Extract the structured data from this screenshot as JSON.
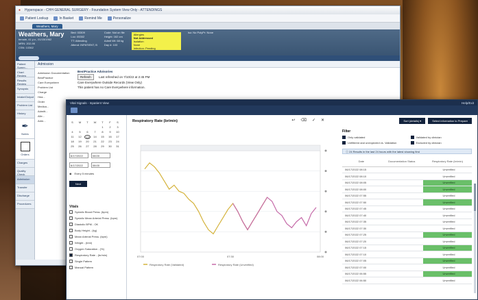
{
  "back_window": {
    "title": "Hyperspace - CHH GENERAL SURGERY - Foundation System View Only - ATTENDINGS",
    "toolbar": [
      "Patient Lookup",
      "In Basket",
      "Remind Me",
      "Personalize"
    ],
    "tab": "Weathers, Mary",
    "patient": {
      "name": "Weathers, Mary",
      "line1": "female, 41 y.o., 01/15/1962",
      "line2": "MRN: 202-98",
      "line3": "CSN: 10362"
    },
    "banner_cols": [
      [
        "Bed: 03309",
        "Loc: 05302",
        "TT: Attending",
        "Attend: INPATIENT, B"
      ],
      [
        "Code: Not on file",
        "Height: 162 cm",
        "Admit Wt: 68 kg",
        "Day #: 103"
      ]
    ],
    "allergy": [
      "Allergies",
      "Not Addressed",
      "Isolation",
      "None",
      "Infection: Pending"
    ],
    "iso_label": "Iso: No PolyPr: None",
    "sidebar": [
      "Patient Summ...",
      "Chart Review",
      "Results Review",
      "Synopsis",
      "Intake/Output",
      "Problem List",
      "History",
      "Notes",
      "Orders",
      "Charges",
      "Quality Check",
      "Admission",
      "Transfer",
      "Discharge",
      "Procedures"
    ],
    "section": "Admission",
    "left_list": [
      "Admission Documentation",
      "BestPractice",
      "Care Everywhere",
      "Problem List",
      "Charge",
      "Hea...",
      "Order",
      "Medica...",
      "Admitt...",
      "Alle...",
      "Adm..."
    ],
    "advisory_title": "BestPractice Advisories",
    "refresh": "Refresh",
    "last_refreshed": "Last refreshed on 7/10/22 at 2:45 PM",
    "care_text": "Care Everywhere Outside Records (View Only)",
    "care_sub": "This patient has no Care Everywhere information."
  },
  "front_window": {
    "title": "Vital Signals - Inpatient View",
    "title_right": "Help/Exit",
    "calendar": {
      "days": [
        "S",
        "M",
        "T",
        "W",
        "T",
        "F",
        "S",
        "",
        "",
        "",
        "",
        "1",
        "2",
        "3",
        "4",
        "5",
        "6",
        "7",
        "8",
        "9",
        "10",
        "11",
        "12",
        "13",
        "14",
        "15",
        "16",
        "17",
        "18",
        "19",
        "20",
        "21",
        "22",
        "23",
        "24",
        "25",
        "26",
        "27",
        "28",
        "29",
        "30",
        "31"
      ],
      "selected": 13
    },
    "from_date": "6/17/2022",
    "from_time": "08:00",
    "to_date": "6/17/2022",
    "to_time": "08:00",
    "interval_label": "Every 5 minutes",
    "next_label": "Next",
    "vitals_title": "Vitals",
    "vitals": [
      {
        "label": "Systolic Blood Press. (bpm)",
        "checked": false
      },
      {
        "label": "Systolic Mean Arterial Press. (bpm)",
        "checked": false
      },
      {
        "label": "Diastolic BPM - OK",
        "checked": false
      },
      {
        "label": "Body Height - (kg)",
        "checked": false
      },
      {
        "label": "Mean Arterial Press. (bpm)",
        "checked": false
      },
      {
        "label": "Weight - (bmi)",
        "checked": false
      },
      {
        "label": "Oxygen Saturation - (%)",
        "checked": false
      },
      {
        "label": "Respiratory Rate - (br/min)",
        "checked": true
      },
      {
        "label": "Single Pattern",
        "checked": false
      },
      {
        "label": "Manual Pattern",
        "checked": false
      }
    ],
    "chart_actions": [
      "↩",
      "⌫",
      "✓",
      "✕"
    ],
    "right": {
      "buttons": [
        "Sort (details) ▾",
        "Select information to Prepare"
      ],
      "filters_title": "Filter",
      "filters": [
        "Only validated",
        "Validated by clinician",
        "Unfiltered and unexpected vs. Validation",
        "Excluded by clinician"
      ],
      "info": "ⓘ 24 Results in the last 24 hours with the latest showing first",
      "columns": [
        "Date",
        "Documentation Status",
        "Respiratory Rate (br/min)"
      ],
      "rows": [
        {
          "date": "06/17/2022 08:15",
          "status": "",
          "value": "Unverified",
          "hl": false
        },
        {
          "date": "06/17/2022 08:10",
          "status": "",
          "value": "Unverified",
          "hl": false
        },
        {
          "date": "06/17/2022 08:05",
          "status": "",
          "value": "Unverified",
          "hl": true
        },
        {
          "date": "06/17/2022 08:00",
          "status": "",
          "value": "Unverified",
          "hl": true
        },
        {
          "date": "06/17/2022 07:55",
          "status": "",
          "value": "Unverified",
          "hl": false
        },
        {
          "date": "06/17/2022 07:50",
          "status": "",
          "value": "Unverified",
          "hl": true
        },
        {
          "date": "06/17/2022 07:45",
          "status": "",
          "value": "Unverified",
          "hl": false
        },
        {
          "date": "06/17/2022 07:40",
          "status": "",
          "value": "Unverified",
          "hl": false
        },
        {
          "date": "06/17/2022 07:35",
          "status": "",
          "value": "Unverified",
          "hl": false
        },
        {
          "date": "06/17/2022 07:30",
          "status": "",
          "value": "Unverified",
          "hl": false
        },
        {
          "date": "06/17/2022 07:25",
          "status": "",
          "value": "Unverified",
          "hl": true
        },
        {
          "date": "06/17/2022 07:20",
          "status": "",
          "value": "Unverified",
          "hl": false
        },
        {
          "date": "06/17/2022 07:15",
          "status": "",
          "value": "Unverified",
          "hl": true
        },
        {
          "date": "06/17/2022 07:10",
          "status": "",
          "value": "Unverified",
          "hl": false
        },
        {
          "date": "06/17/2022 07:05",
          "status": "",
          "value": "Unverified",
          "hl": true
        },
        {
          "date": "06/17/2022 07:00",
          "status": "",
          "value": "Unverified",
          "hl": false
        },
        {
          "date": "06/17/2022 06:55",
          "status": "",
          "value": "Unverified",
          "hl": true
        },
        {
          "date": "06/17/2022 06:50",
          "status": "",
          "value": "Unverified",
          "hl": false
        }
      ]
    }
  },
  "chart_data": {
    "type": "line",
    "title": "Respiratory Rate (br/min)",
    "subtitle": "",
    "xlabel": "",
    "ylabel": "",
    "x_ticks": [
      "07:00",
      "07:30",
      "08:00"
    ],
    "y_ticks_left": [
      "",
      "",
      "",
      "",
      "",
      ""
    ],
    "ylim": [
      0,
      100
    ],
    "legend": [
      "Respiratory Rate (Validated)",
      "Respiratory Rate (Unverified)"
    ],
    "series": [
      {
        "name": "Respiratory Rate (Validated)",
        "color": "#d4b23a",
        "values": [
          82,
          88,
          84,
          78,
          70,
          62,
          66,
          60,
          58,
          52,
          48,
          40,
          30,
          22,
          18,
          26,
          34,
          42,
          48,
          40,
          30,
          22,
          30,
          38,
          46,
          54
        ]
      },
      {
        "name": "Respiratory Rate (Unverified)",
        "color": "#c56aa8",
        "values": [
          null,
          null,
          null,
          null,
          null,
          null,
          null,
          null,
          null,
          null,
          null,
          null,
          null,
          null,
          null,
          null,
          null,
          null,
          48,
          40,
          30,
          22,
          30,
          38,
          46,
          54,
          50,
          40,
          36,
          28,
          24,
          30,
          34,
          26,
          38,
          44
        ]
      }
    ]
  }
}
